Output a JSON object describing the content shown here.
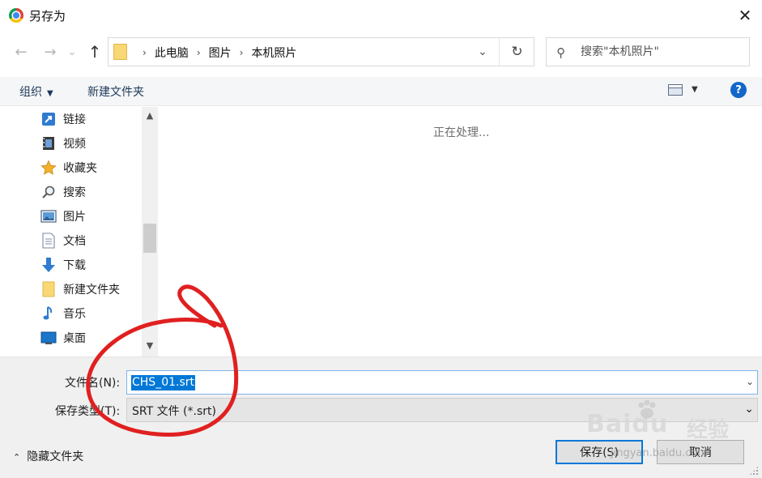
{
  "window": {
    "title": "另存为",
    "close_glyph": "✕"
  },
  "navigation": {
    "back_glyph": "←",
    "forward_glyph": "→",
    "recent_glyph": "⌄",
    "up_glyph": "↑"
  },
  "address_bar": {
    "path": [
      "此电脑",
      "图片",
      "本机照片"
    ],
    "separator": "›",
    "dropdown_glyph": "⌄",
    "refresh_glyph": "↻"
  },
  "search": {
    "placeholder": "搜索\"本机照片\"",
    "icon_glyph": "⚲"
  },
  "toolbar": {
    "organize_label": "组织",
    "organize_caret": "▼",
    "new_folder_label": "新建文件夹",
    "view_caret": "▼",
    "help_glyph": "?"
  },
  "nav_pane": {
    "items": [
      {
        "label": "链接",
        "icon": "link-arrow-icon"
      },
      {
        "label": "视频",
        "icon": "video-icon"
      },
      {
        "label": "收藏夹",
        "icon": "star-icon"
      },
      {
        "label": "搜索",
        "icon": "search-icon"
      },
      {
        "label": "图片",
        "icon": "picture-icon"
      },
      {
        "label": "文档",
        "icon": "document-icon"
      },
      {
        "label": "下载",
        "icon": "download-icon"
      },
      {
        "label": "新建文件夹",
        "icon": "folder-icon"
      },
      {
        "label": "音乐",
        "icon": "music-icon"
      },
      {
        "label": "桌面",
        "icon": "desktop-icon"
      }
    ],
    "scroll_up_glyph": "▲",
    "scroll_down_glyph": "▼"
  },
  "content": {
    "status": "正在处理..."
  },
  "bottom": {
    "filename_label": "文件名(N):",
    "filename_value": "CHS_01.srt",
    "filetype_label": "保存类型(T):",
    "filetype_value": "SRT 文件 (*.srt)",
    "dropdown_glyph": "⌄",
    "hide_folders_label": "隐藏文件夹",
    "hide_folders_glyph": "⌃",
    "save_label": "保存(S)",
    "cancel_label": "取消"
  },
  "watermark": {
    "brand": "Baidu",
    "product": "经验",
    "url": "jingyan.baidu.com"
  },
  "colors": {
    "accent": "#0078d7",
    "annotation": "#e02020",
    "folder": "#f8d775",
    "help": "#1166c9"
  }
}
